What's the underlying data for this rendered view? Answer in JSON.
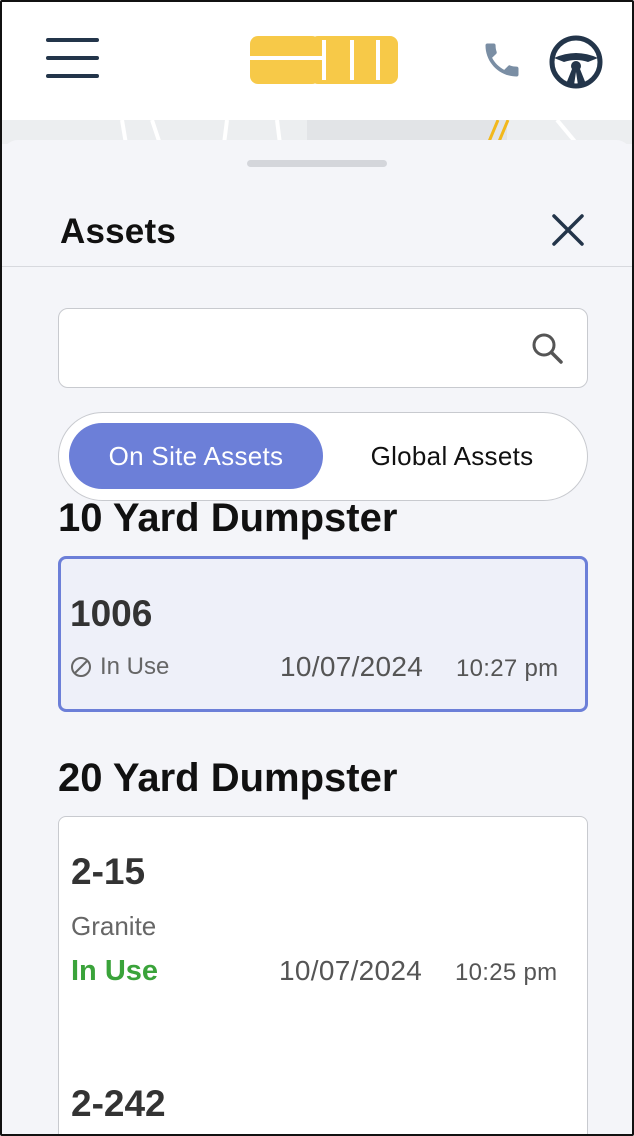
{
  "header": {
    "menu_icon": "hamburger-menu-icon",
    "logo_icon": "company-logo",
    "brand_color": "#f7c948",
    "phone_icon": "phone-icon",
    "driver_icon": "steering-wheel-icon"
  },
  "sheet": {
    "title": "Assets",
    "close_icon": "close-icon",
    "search": {
      "value": "",
      "placeholder": "",
      "icon": "search-icon"
    },
    "tabs": [
      {
        "label": "On Site Assets",
        "active": true
      },
      {
        "label": "Global Assets",
        "active": false
      }
    ],
    "accent_color": "#6c7fd8",
    "groups": [
      {
        "title": "10 Yard Dumpster",
        "assets": [
          {
            "id": "1006",
            "status": "In Use",
            "status_icon": "ban-icon",
            "date": "10/07/2024",
            "time": "10:27 pm",
            "selected": true
          }
        ]
      },
      {
        "title": "20 Yard Dumpster",
        "assets": [
          {
            "id": "2-15",
            "location": "Granite",
            "status": "In Use",
            "status_color": "#3aa33a",
            "date": "10/07/2024",
            "time": "10:25 pm"
          },
          {
            "id": "2-242"
          }
        ]
      }
    ]
  }
}
